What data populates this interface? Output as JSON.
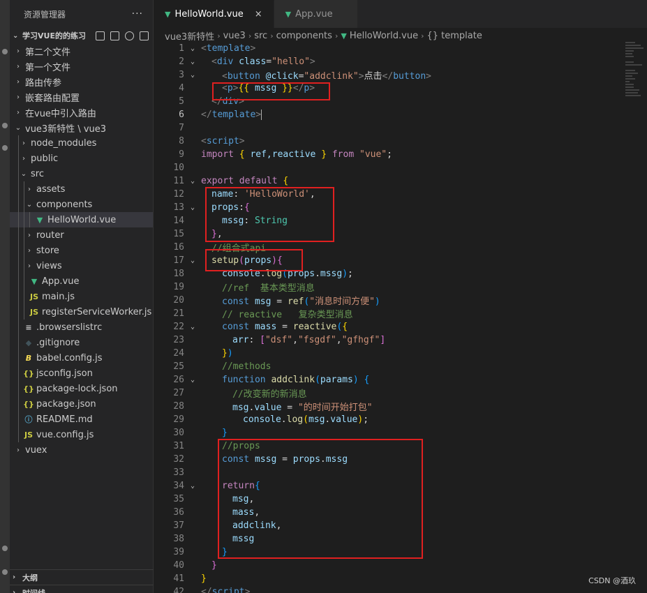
{
  "sidebar": {
    "title": "资源管理器",
    "more": "···",
    "workspace": "学习VUE的的练习",
    "items": [
      {
        "label": "第二个文件",
        "kind": "folder"
      },
      {
        "label": "第一个文件",
        "kind": "folder"
      },
      {
        "label": "路由传参",
        "kind": "folder"
      },
      {
        "label": "嵌套路由配置",
        "kind": "folder"
      },
      {
        "label": "在vue中引入路由",
        "kind": "folder"
      },
      {
        "label": "vue3新特性 \\ vue3",
        "kind": "folder-open"
      },
      {
        "label": "node_modules",
        "kind": "folder"
      },
      {
        "label": "public",
        "kind": "folder"
      },
      {
        "label": "src",
        "kind": "folder-open"
      },
      {
        "label": "assets",
        "kind": "folder"
      },
      {
        "label": "components",
        "kind": "folder-open"
      },
      {
        "label": "HelloWorld.vue",
        "kind": "vue"
      },
      {
        "label": "router",
        "kind": "folder"
      },
      {
        "label": "store",
        "kind": "folder"
      },
      {
        "label": "views",
        "kind": "folder"
      },
      {
        "label": "App.vue",
        "kind": "vue"
      },
      {
        "label": "main.js",
        "kind": "js"
      },
      {
        "label": "registerServiceWorker.js",
        "kind": "js"
      },
      {
        "label": ".browserslistrc",
        "kind": "list"
      },
      {
        "label": ".gitignore",
        "kind": "git"
      },
      {
        "label": "babel.config.js",
        "kind": "babel"
      },
      {
        "label": "jsconfig.json",
        "kind": "json"
      },
      {
        "label": "package-lock.json",
        "kind": "json"
      },
      {
        "label": "package.json",
        "kind": "json"
      },
      {
        "label": "README.md",
        "kind": "md"
      },
      {
        "label": "vue.config.js",
        "kind": "js"
      },
      {
        "label": "vuex",
        "kind": "folder"
      }
    ],
    "outline": "大纲",
    "timeline": "时间线"
  },
  "tabs": [
    {
      "label": "HelloWorld.vue",
      "close": "×"
    },
    {
      "label": "App.vue"
    }
  ],
  "breadcrumb": [
    "vue3新特性",
    "vue3",
    "src",
    "components",
    "HelloWorld.vue",
    "{} template"
  ],
  "code": {
    "line_numbers": [
      "1",
      "2",
      "3",
      "4",
      "5",
      "6",
      "7",
      "8",
      "9",
      "10",
      "11",
      "12",
      "13",
      "14",
      "15",
      "16",
      "17",
      "18",
      "19",
      "20",
      "21",
      "22",
      "23",
      "24",
      "25",
      "26",
      "27",
      "28",
      "29",
      "30",
      "31",
      "32",
      "33",
      "34",
      "35",
      "36",
      "37",
      "38",
      "39",
      "40",
      "41",
      "42"
    ],
    "l1": [
      "<",
      "template",
      ">"
    ],
    "l2": [
      "<",
      "div",
      " ",
      "class",
      "=",
      "\"hello\"",
      ">"
    ],
    "l3": [
      "<",
      "button",
      " ",
      "@click",
      "=",
      "\"addclink\"",
      ">",
      "点击",
      "</",
      "button",
      ">"
    ],
    "l4": [
      "<",
      "p",
      ">",
      "{{ ",
      "mssg",
      " }}",
      "</",
      "p",
      ">"
    ],
    "l5": [
      "</",
      "div",
      ">"
    ],
    "l6": [
      "</",
      "template",
      ">"
    ],
    "l8": [
      "<",
      "script",
      ">"
    ],
    "l9": [
      "import",
      " ",
      "{",
      " ref,reactive ",
      "}",
      " ",
      "from",
      " ",
      "\"vue\"",
      ";"
    ],
    "l11": [
      "export",
      " ",
      "default",
      " ",
      "{"
    ],
    "l12": [
      "name",
      ": ",
      "'HelloWorld'",
      ","
    ],
    "l13": [
      "props",
      ":",
      "{"
    ],
    "l14": [
      "mssg",
      ": ",
      "String"
    ],
    "l15": [
      "}",
      ","
    ],
    "l16": [
      "//组合式api"
    ],
    "l17": [
      "setup",
      "(",
      "props",
      ")",
      "{"
    ],
    "l18": [
      "console",
      ".",
      "log",
      "(",
      "props",
      ".",
      "mssg",
      ")",
      ";"
    ],
    "l19": [
      "//ref  基本类型消息"
    ],
    "l20": [
      "const",
      " ",
      "msg",
      " = ",
      "ref",
      "(",
      "\"消息时间方便\"",
      ")"
    ],
    "l21": [
      "// reactive   复杂类型消息"
    ],
    "l22": [
      "const",
      " ",
      "mass",
      " = ",
      "reactive",
      "(",
      "{"
    ],
    "l23": [
      "arr",
      ": ",
      "[",
      "\"dsf\"",
      ",",
      "\"fsgdf\"",
      ",",
      "\"gfhgf\"",
      "]"
    ],
    "l24": [
      "}",
      ")"
    ],
    "l25": [
      "//methods"
    ],
    "l26": [
      "function",
      " ",
      "addclink",
      "(",
      "params",
      ") ",
      "{"
    ],
    "l27": [
      "//改变新的新消息"
    ],
    "l28": [
      "msg",
      ".",
      "value",
      " = ",
      "\"的时间开始打包\""
    ],
    "l29": [
      "console",
      ".",
      "log",
      "(",
      "msg",
      ".",
      "value",
      ")",
      ";"
    ],
    "l30": [
      "}"
    ],
    "l31": [
      "//props"
    ],
    "l32": [
      "const",
      " ",
      "mssg",
      " = ",
      "props",
      ".",
      "mssg"
    ],
    "l34": [
      "return",
      "{"
    ],
    "l35": [
      "msg",
      ","
    ],
    "l36": [
      "mass",
      ","
    ],
    "l37": [
      "addclink",
      ","
    ],
    "l38": [
      "mssg"
    ],
    "l39": [
      "}"
    ],
    "l40": [
      "}"
    ],
    "l41": [
      "}"
    ],
    "l42": [
      "</",
      "script",
      ">"
    ]
  },
  "watermark": "CSDN @酒玖",
  "colors": {
    "highlight_box": "#e02020",
    "vue_green": "#41b883",
    "editor_bg": "#1e1e1e"
  }
}
